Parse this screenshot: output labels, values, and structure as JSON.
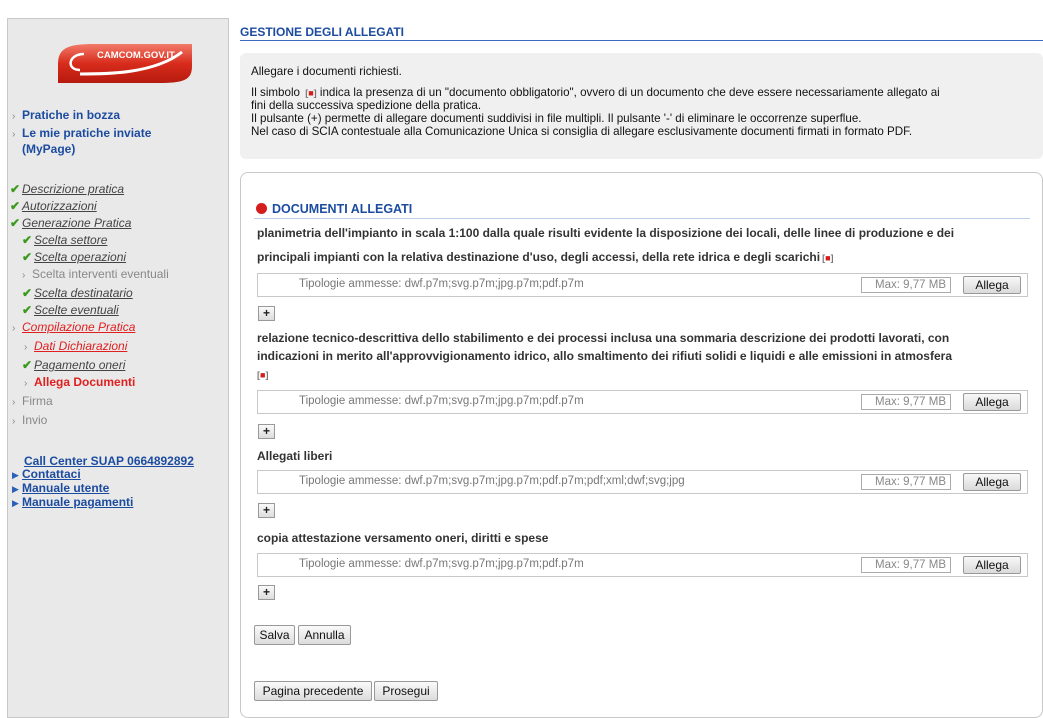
{
  "logo": {
    "text": "CAMCOM.GOV.IT"
  },
  "sidebar": {
    "top_links": [
      {
        "label": "Pratiche in bozza"
      },
      {
        "label": "Le mie pratiche inviate"
      },
      {
        "label": "(MyPage)"
      }
    ],
    "steps": [
      {
        "label": "Descrizione pratica"
      },
      {
        "label": "Autorizzazioni"
      },
      {
        "label": "Generazione Pratica"
      },
      {
        "label": "Scelta settore"
      },
      {
        "label": "Scelta operazioni"
      },
      {
        "label": "Scelta interventi eventuali"
      },
      {
        "label": "Scelta destinatario"
      },
      {
        "label": "Scelte eventuali"
      },
      {
        "label": "Compilazione Pratica"
      },
      {
        "label": "Dati Dichiarazioni"
      },
      {
        "label": "Pagamento oneri"
      },
      {
        "label": "Allega Documenti"
      },
      {
        "label": "Firma"
      },
      {
        "label": "Invio"
      }
    ],
    "bottom_links": [
      {
        "label": "Call Center SUAP 0664892892"
      },
      {
        "label": "Contattaci"
      },
      {
        "label": "Manuale utente"
      },
      {
        "label": "Manuale pagamenti"
      }
    ]
  },
  "main": {
    "title": "GESTIONE DEGLI ALLEGATI",
    "info": [
      "Allegare i documenti richiesti.",
      "Il simbolo",
      "indica la presenza di un \"documento obbligatorio\", ovvero di un documento che deve essere necessariamente allegato ai",
      "fini della successiva spedizione della pratica.",
      "Il pulsante (+) permette di allegare documenti suddivisi in file multipli. Il pulsante '-' di eliminare le occorrenze superflue.",
      "Nel caso di SCIA contestuale alla Comunicazione Unica si consiglia di allegare esclusivamente documenti firmati in formato PDF."
    ],
    "section_title": "DOCUMENTI ALLEGATI",
    "documents": [
      {
        "title_lines": [
          "planimetria dell'impianto in scala 1:100 dalla quale risulti evidente la disposizione dei locali, delle linee di produzione e dei",
          "principali impianti con la relativa destinazione d'uso, degli accessi, della rete idrica e degli scarichi"
        ],
        "types": "Tipologie ammesse: dwf.p7m;svg.p7m;jpg.p7m;pdf.p7m",
        "max": "Max: 9,77 MB",
        "button": "Allega"
      },
      {
        "title_lines": [
          "relazione tecnico-descrittiva dello stabilimento e dei processi inclusa una sommaria descrizione dei prodotti lavorati, con",
          "indicazioni in merito all'approvvigionamento idrico, allo smaltimento dei rifiuti solidi e liquidi e alle emissioni in atmosfera"
        ],
        "types": "Tipologie ammesse: dwf.p7m;svg.p7m;jpg.p7m;pdf.p7m",
        "max": "Max: 9,77 MB",
        "button": "Allega"
      },
      {
        "title_lines": [
          "Allegati liberi"
        ],
        "types": "Tipologie ammesse: dwf.p7m;svg.p7m;jpg.p7m;pdf.p7m;pdf;xml;dwf;svg;jpg",
        "max": "Max: 9,77 MB",
        "button": "Allega"
      },
      {
        "title_lines": [
          "copia attestazione versamento oneri, diritti e spese"
        ],
        "types": "Tipologie ammesse: dwf.p7m;svg.p7m;jpg.p7m;pdf.p7m",
        "max": "Max: 9,77 MB",
        "button": "Allega"
      }
    ],
    "plus_label": "+",
    "buttons": {
      "save": "Salva",
      "cancel": "Annulla",
      "prev": "Pagina precedente",
      "next": "Prosegui"
    }
  },
  "colors": {
    "accent": "#1c4ca0",
    "active": "#e02020",
    "done_check": "#3a9a1a",
    "required_marker": "#d41e1e"
  }
}
